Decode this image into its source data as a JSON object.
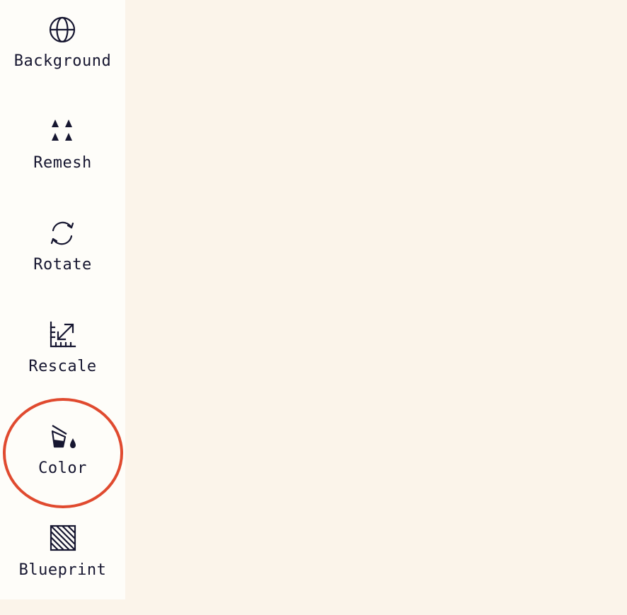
{
  "sidebar": {
    "items": [
      {
        "id": "background",
        "label": "Background",
        "icon": "globe-icon"
      },
      {
        "id": "remesh",
        "label": "Remesh",
        "icon": "triangles-grid-icon"
      },
      {
        "id": "rotate",
        "label": "Rotate",
        "icon": "rotate-arrows-icon"
      },
      {
        "id": "rescale",
        "label": "Rescale",
        "icon": "ruler-rescale-icon"
      },
      {
        "id": "color",
        "label": "Color",
        "icon": "paint-bucket-icon"
      },
      {
        "id": "blueprint",
        "label": "Blueprint",
        "icon": "hatched-square-icon"
      }
    ],
    "highlighted_item": "color"
  },
  "colors": {
    "sidebar_bg": "#fefdf9",
    "canvas_bg": "#fbf4ea",
    "text": "#161630",
    "highlight_ring": "#e04a2f"
  }
}
